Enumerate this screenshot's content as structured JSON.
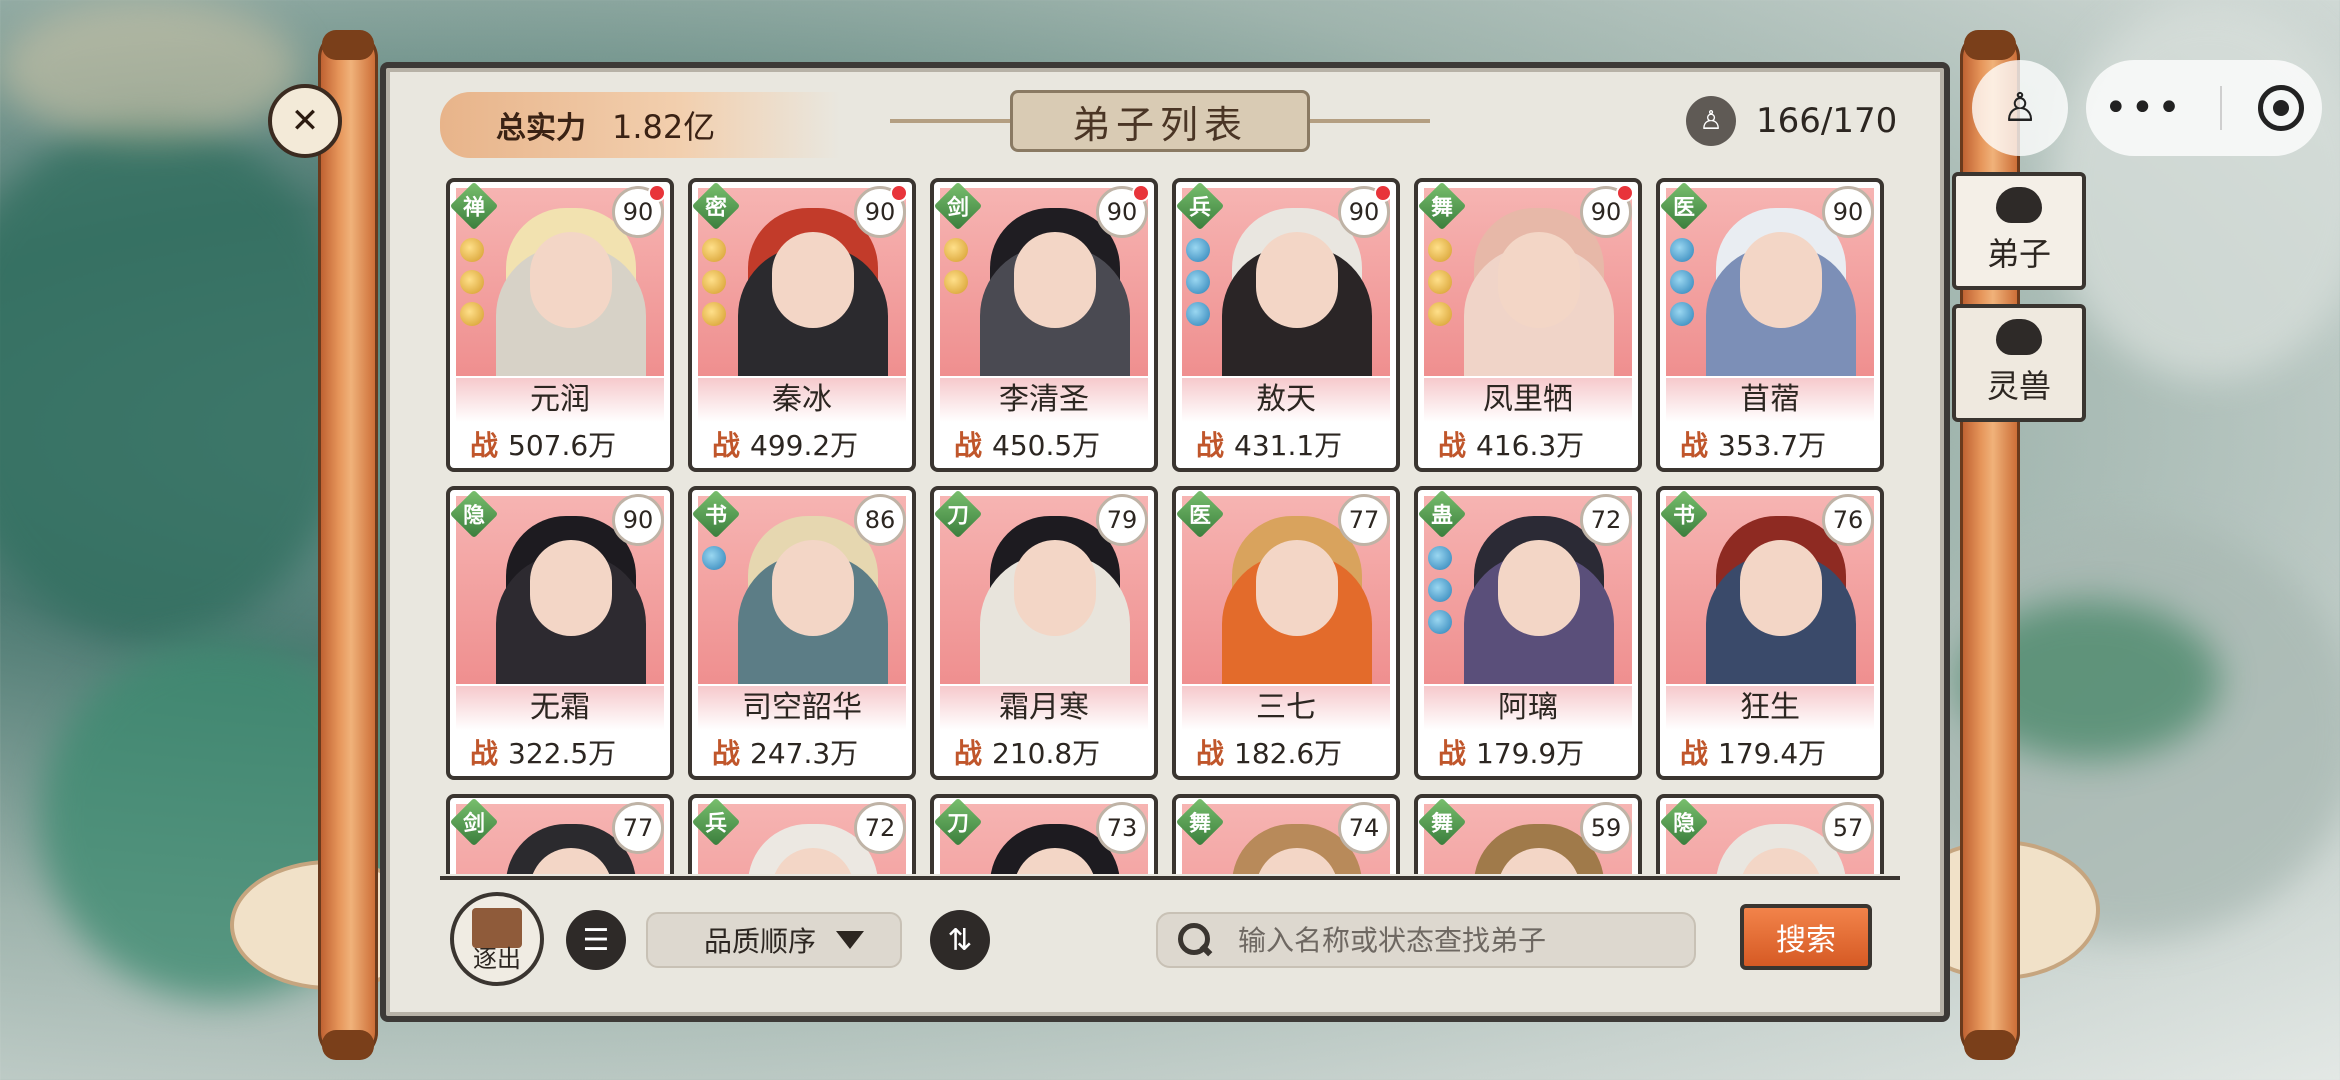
{
  "header": {
    "power_label": "总实力",
    "power_value": "1.82亿",
    "title": "弟子列表",
    "count": "166/170"
  },
  "side_tabs": [
    {
      "label": "弟子"
    },
    {
      "label": "灵兽"
    }
  ],
  "cards": [
    {
      "name": "元润",
      "class": "禅",
      "level": "90",
      "power_label": "战",
      "power": "507.6万",
      "dot": true,
      "pips": [
        "gold",
        "gold",
        "gold"
      ],
      "hair": "#f2e2b0",
      "robe": "#d7d2c7"
    },
    {
      "name": "秦冰",
      "class": "密",
      "level": "90",
      "power_label": "战",
      "power": "499.2万",
      "dot": true,
      "pips": [
        "gold",
        "gold",
        "gold"
      ],
      "hair": "#c23b2a",
      "robe": "#2b2a2e"
    },
    {
      "name": "李清圣",
      "class": "剑",
      "level": "90",
      "power_label": "战",
      "power": "450.5万",
      "dot": true,
      "pips": [
        "gold",
        "gold"
      ],
      "hair": "#1f1d22",
      "robe": "#4a4a52"
    },
    {
      "name": "敖天",
      "class": "兵",
      "level": "90",
      "power_label": "战",
      "power": "431.1万",
      "dot": true,
      "pips": [
        "blue",
        "blue",
        "blue"
      ],
      "hair": "#e9e6e0",
      "robe": "#2a2526"
    },
    {
      "name": "凤里牺",
      "class": "舞",
      "level": "90",
      "power_label": "战",
      "power": "416.3万",
      "dot": true,
      "pips": [
        "gold",
        "gold",
        "gold"
      ],
      "hair": "#e7b8a8",
      "robe": "#f0d4c8"
    },
    {
      "name": "苜蓿",
      "class": "医",
      "level": "90",
      "power_label": "战",
      "power": "353.7万",
      "dot": false,
      "pips": [
        "blue",
        "blue",
        "blue"
      ],
      "hair": "#e9edf2",
      "robe": "#7c8fb7"
    },
    {
      "name": "无霜",
      "class": "隐",
      "level": "90",
      "power_label": "战",
      "power": "322.5万",
      "dot": false,
      "pips": [],
      "hair": "#1d1b20",
      "robe": "#2d2a30"
    },
    {
      "name": "司空韶华",
      "class": "书",
      "level": "86",
      "power_label": "战",
      "power": "247.3万",
      "dot": false,
      "pips": [
        "blue"
      ],
      "hair": "#e6d7b0",
      "robe": "#5c7d86"
    },
    {
      "name": "霜月寒",
      "class": "刀",
      "level": "79",
      "power_label": "战",
      "power": "210.8万",
      "dot": false,
      "pips": [],
      "hair": "#1d1b20",
      "robe": "#e8e4dc"
    },
    {
      "name": "三七",
      "class": "医",
      "level": "77",
      "power_label": "战",
      "power": "182.6万",
      "dot": false,
      "pips": [],
      "hair": "#d9a35d",
      "robe": "#e36b2b"
    },
    {
      "name": "阿璃",
      "class": "蛊",
      "level": "72",
      "power_label": "战",
      "power": "179.9万",
      "dot": false,
      "pips": [
        "blue",
        "blue",
        "blue"
      ],
      "hair": "#2b2a35",
      "robe": "#5a4f7a"
    },
    {
      "name": "狂生",
      "class": "书",
      "level": "76",
      "power_label": "战",
      "power": "179.4万",
      "dot": false,
      "pips": [],
      "hair": "#8e2a22",
      "robe": "#3a4a6a"
    },
    {
      "name": "",
      "class": "剑",
      "level": "77",
      "power_label": "",
      "power": "",
      "dot": false,
      "pips": [],
      "hair": "#2b2a2e",
      "robe": "#2b2a2e"
    },
    {
      "name": "",
      "class": "兵",
      "level": "72",
      "power_label": "",
      "power": "",
      "dot": false,
      "pips": [],
      "hair": "#ece8e2",
      "robe": "#ece8e2"
    },
    {
      "name": "",
      "class": "刀",
      "level": "73",
      "power_label": "",
      "power": "",
      "dot": false,
      "pips": [],
      "hair": "#1d1b20",
      "robe": "#1d1b20"
    },
    {
      "name": "",
      "class": "舞",
      "level": "74",
      "power_label": "",
      "power": "",
      "dot": false,
      "pips": [],
      "hair": "#b88a5a",
      "robe": "#b88a5a"
    },
    {
      "name": "",
      "class": "舞",
      "level": "59",
      "power_label": "",
      "power": "",
      "dot": false,
      "pips": [],
      "hair": "#a07a4a",
      "robe": "#a07a4a"
    },
    {
      "name": "",
      "class": "隐",
      "level": "57",
      "power_label": "",
      "power": "",
      "dot": false,
      "pips": [],
      "hair": "#e9e6e0",
      "robe": "#e9e6e0"
    }
  ],
  "toolbar": {
    "expel_label": "逐出",
    "sort_value": "品质顺序",
    "search_placeholder": "输入名称或状态查找弟子",
    "search_button": "搜索"
  },
  "colors": {
    "card_bg": "#ef8f8f",
    "accent_orange": "#d65a24",
    "class_badge": "#3a7d3c"
  },
  "icons": [
    "hammer-icon",
    "person-icon",
    "more-dots-icon",
    "target-icon",
    "mask-icon",
    "beast-icon",
    "book-icon",
    "filter-list-icon",
    "chevron-down-icon",
    "swap-vertical-icon",
    "search-icon"
  ]
}
